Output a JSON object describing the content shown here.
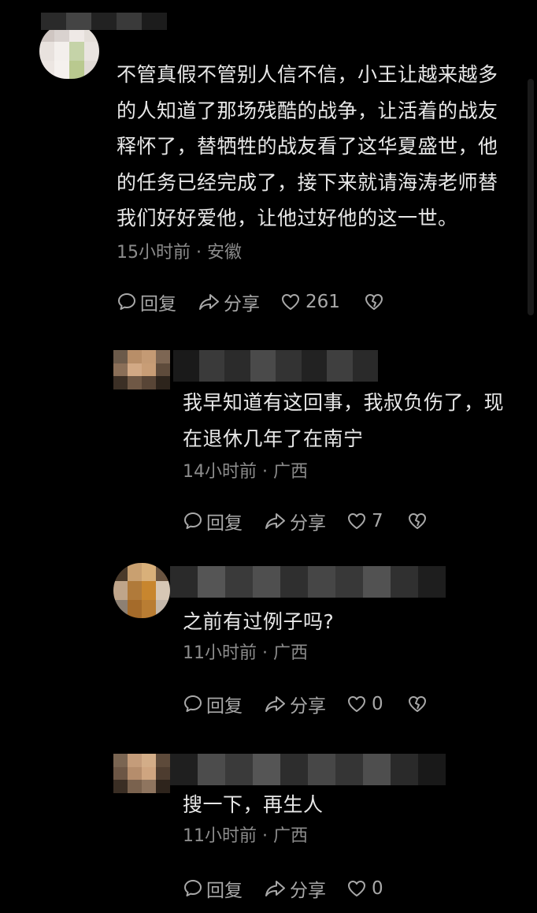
{
  "comments": [
    {
      "text_lines": [
        "不管真假不管别人信不信，小王让越来越多",
        "的人知道了那场残酷的战争，让活着的战友",
        "释怀了，替牺牲的战友看了这华夏盛世，他",
        "的任务已经完成了，接下来就请海涛老师替",
        "我们好好爱他，让他过好他的这一世。"
      ],
      "meta": "15小时前 · 安徽",
      "reply": "回复",
      "share": "分享",
      "likes": "261"
    },
    {
      "text_lines": [
        "我早知道有这回事，我叔负伤了，现",
        "在退休几年了在南宁"
      ],
      "meta": "14小时前 · 广西",
      "reply": "回复",
      "share": "分享",
      "likes": "7"
    },
    {
      "text_lines": [
        "之前有过例子吗?"
      ],
      "meta": "11小时前 · 广西",
      "reply": "回复",
      "share": "分享",
      "likes": "0"
    },
    {
      "text_lines": [
        "搜一下，再生人"
      ],
      "meta": "11小时前 · 广西",
      "reply": "回复",
      "share": "分享",
      "likes": "0"
    }
  ],
  "icons": {
    "reply": "speech-bubble-icon",
    "share": "share-arrow-icon",
    "like": "heart-outline-icon",
    "dislike": "broken-heart-icon"
  },
  "colors": {
    "background": "#000000",
    "text": "#e8e8e8",
    "meta": "#8c8c8c",
    "action": "#a8a8a8"
  }
}
